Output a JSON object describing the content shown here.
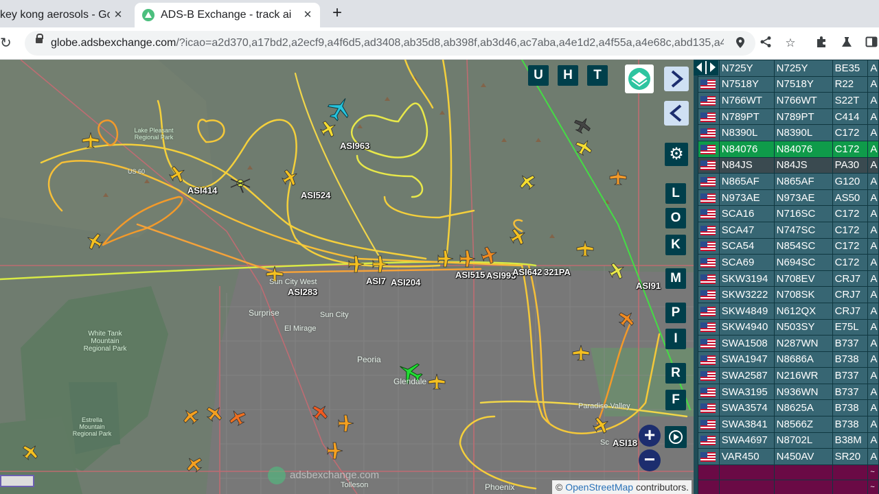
{
  "browser": {
    "tabs": [
      {
        "label": "key kong aerosols - Go",
        "close": "✕"
      },
      {
        "label": "ADS-B Exchange - track ai",
        "close": "✕"
      }
    ],
    "new_tab": "+",
    "url_host": "globe.adsbexchange.com",
    "url_path": "/?icao=a2d370,a17bd2,a2ecf9,a4f6d5,ad3408,ab35d8,ab398f,ab3d46,ac7aba,a4e1d2,a4f55a,a4e68c,abd135,a4...",
    "icons": [
      "reload-icon",
      "lock-icon",
      "location-icon",
      "share-icon",
      "star-icon",
      "extensions-icon",
      "labs-icon",
      "sidepanel-icon"
    ]
  },
  "map": {
    "controls": {
      "top": [
        "U",
        "H",
        "T"
      ],
      "side": [
        "L",
        "O",
        "K",
        "M",
        "P",
        "I",
        "R",
        "F"
      ],
      "zoom_in": "+",
      "zoom_out": "−"
    },
    "plane_labels": [
      "ASI963",
      "ASI414",
      "ASI524",
      "ASI283",
      "ASI7",
      "ASI204",
      "ASI515",
      "ASI993",
      "ASI642",
      "321PA",
      "ASI91",
      "ASI18"
    ],
    "place_labels": [
      "Surprise",
      "Sun City",
      "Sun City West",
      "El Mirage",
      "Peoria",
      "Glendale",
      "Paradise Valley",
      "Phoenix",
      "Tolleson",
      "Sc",
      "US 60"
    ],
    "park_labels": [
      "White Tank Mountain Regional Park",
      "Estrella Mountain Regional Park",
      "Lake Pleasant Regional Park"
    ],
    "watermark": "adsbexchange.com",
    "attribution_prefix": "©",
    "attribution_link": "OpenStreetMap",
    "attribution_suffix": "contributors."
  },
  "table": {
    "rows": [
      {
        "callsign": "N725Y",
        "reg": "N725Y",
        "type": "BE35",
        "extra": "A"
      },
      {
        "callsign": "N7518Y",
        "reg": "N7518Y",
        "type": "R22",
        "extra": "A"
      },
      {
        "callsign": "N766WT",
        "reg": "N766WT",
        "type": "S22T",
        "extra": "A"
      },
      {
        "callsign": "N789PT",
        "reg": "N789PT",
        "type": "C414",
        "extra": "A"
      },
      {
        "callsign": "N8390L",
        "reg": "N8390L",
        "type": "C172",
        "extra": "A"
      },
      {
        "callsign": "N84076",
        "reg": "N84076",
        "type": "C172",
        "extra": "A"
      },
      {
        "callsign": "N84JS",
        "reg": "N84JS",
        "type": "PA30",
        "extra": "A"
      },
      {
        "callsign": "N865AF",
        "reg": "N865AF",
        "type": "G120",
        "extra": "A"
      },
      {
        "callsign": "N973AE",
        "reg": "N973AE",
        "type": "AS50",
        "extra": "A"
      },
      {
        "callsign": "SCA16",
        "reg": "N716SC",
        "type": "C172",
        "extra": "A"
      },
      {
        "callsign": "SCA47",
        "reg": "N747SC",
        "type": "C172",
        "extra": "A"
      },
      {
        "callsign": "SCA54",
        "reg": "N854SC",
        "type": "C172",
        "extra": "A"
      },
      {
        "callsign": "SCA69",
        "reg": "N694SC",
        "type": "C172",
        "extra": "A"
      },
      {
        "callsign": "SKW3194",
        "reg": "N708EV",
        "type": "CRJ7",
        "extra": "A"
      },
      {
        "callsign": "SKW3222",
        "reg": "N708SK",
        "type": "CRJ7",
        "extra": "A"
      },
      {
        "callsign": "SKW4849",
        "reg": "N612QX",
        "type": "CRJ7",
        "extra": "A"
      },
      {
        "callsign": "SKW4940",
        "reg": "N503SY",
        "type": "E75L",
        "extra": "A"
      },
      {
        "callsign": "SWA1508",
        "reg": "N287WN",
        "type": "B737",
        "extra": "A"
      },
      {
        "callsign": "SWA1947",
        "reg": "N8686A",
        "type": "B738",
        "extra": "A"
      },
      {
        "callsign": "SWA2587",
        "reg": "N216WR",
        "type": "B737",
        "extra": "A"
      },
      {
        "callsign": "SWA3195",
        "reg": "N936WN",
        "type": "B737",
        "extra": "A"
      },
      {
        "callsign": "SWA3574",
        "reg": "N8625A",
        "type": "B738",
        "extra": "A"
      },
      {
        "callsign": "SWA3841",
        "reg": "N8566Z",
        "type": "B738",
        "extra": "A"
      },
      {
        "callsign": "SWA4697",
        "reg": "N8702L",
        "type": "B38M",
        "extra": "A"
      },
      {
        "callsign": "VAR450",
        "reg": "N450AV",
        "type": "SR20",
        "extra": "A"
      }
    ],
    "empty_marker": "~",
    "selected_row": "N84076",
    "dark_row": "N84JS"
  },
  "colors": {
    "control_bg": "#003f4b",
    "table_row": "#376673",
    "table_selected": "#0f9b4a",
    "table_empty": "#6a0a45",
    "track_yellow": "#f2d43a",
    "track_orange": "#f39a2a",
    "plane_selected": "#22dd33",
    "plane_cyan": "#26c4dd"
  }
}
